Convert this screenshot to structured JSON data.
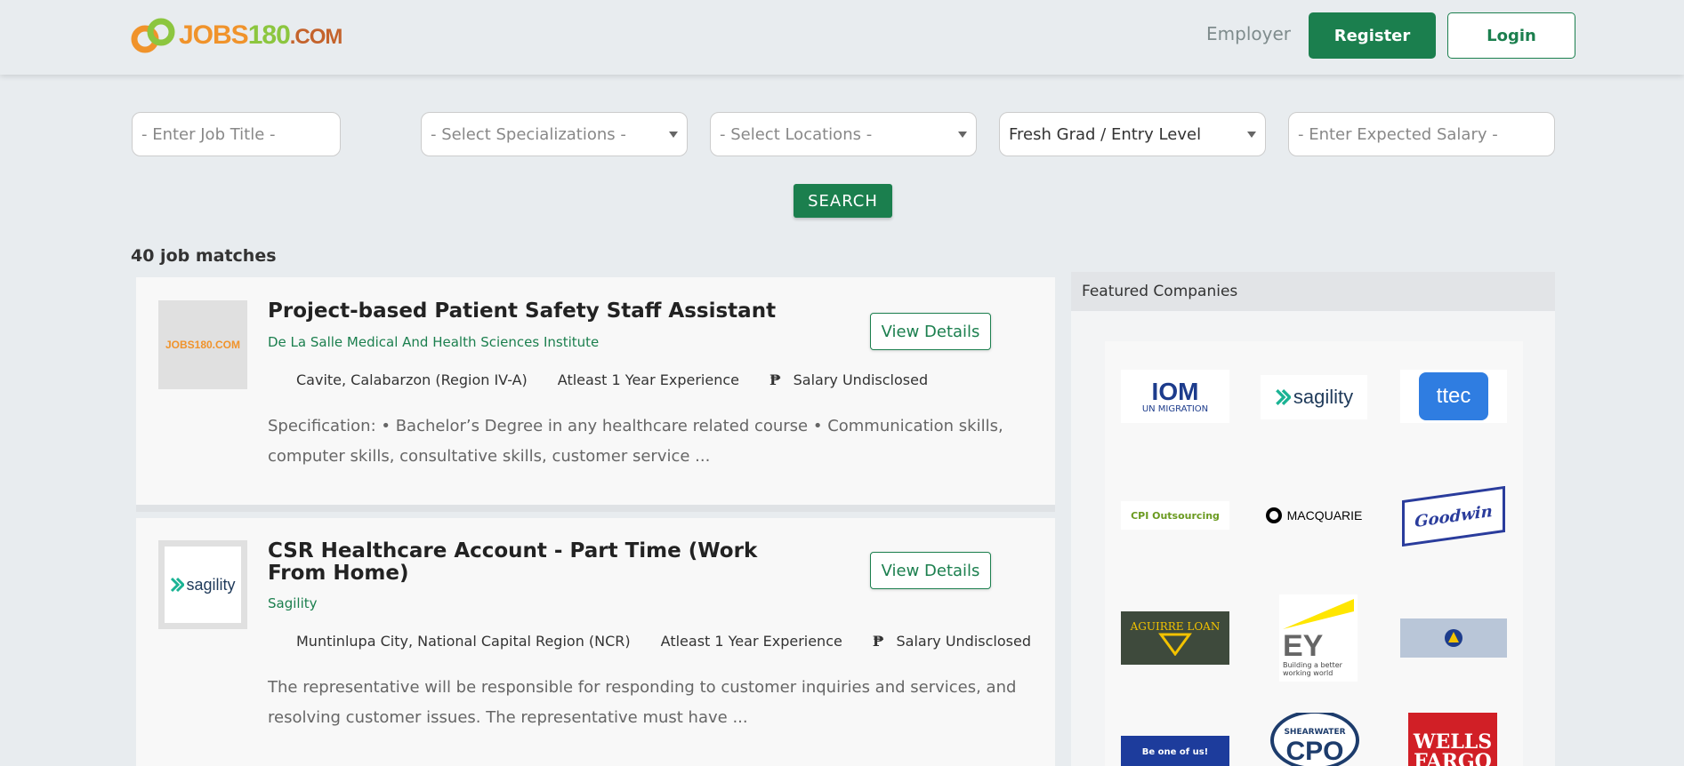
{
  "header": {
    "logo": {
      "jobs": "JOBS",
      "num": "180",
      "com": ".COM"
    },
    "employer_label": "Employer",
    "register_label": "Register",
    "login_label": "Login"
  },
  "search": {
    "job_title_placeholder": "- Enter Job Title -",
    "specialization": "- Select Specializations -",
    "location": "- Select Locations -",
    "level": "Fresh Grad / Entry Level",
    "salary_placeholder": "- Enter Expected Salary -",
    "search_label": "SEARCH"
  },
  "results": {
    "count_label": "40 job matches",
    "jobs": [
      {
        "title": "Project-based Patient Safety Staff Assistant",
        "company": "De La Salle Medical And Health Sciences Institute",
        "location": "Cavite, Calabarzon (Region IV-A)",
        "experience": "Atleast 1 Year Experience",
        "currency": "₱",
        "salary": "Salary Undisclosed",
        "description": "Specification: • Bachelor’s Degree in any healthcare related course • Communication skills, computer skills, consultative skills, customer service ...",
        "view_label": "View Details",
        "logo_text": "JOBS180.COM"
      },
      {
        "title": "CSR Healthcare Account - Part Time (Work From Home)",
        "company": "Sagility",
        "location": "Muntinlupa City, National Capital Region (NCR)",
        "experience": "Atleast 1 Year Experience",
        "currency": "₱",
        "salary": "Salary Undisclosed",
        "description": "The representative will be responsible for responding to customer inquiries and services, and resolving customer issues. The representative must have ...",
        "view_label": "View Details",
        "logo_text": "sagility"
      }
    ]
  },
  "featured": {
    "title": "Featured Companies",
    "companies": [
      {
        "name": "IOM",
        "sub": "UN MIGRATION"
      },
      {
        "name": "sagility"
      },
      {
        "name": "ttec"
      },
      {
        "name": "CPI Outsourcing"
      },
      {
        "name": "MACQUARIE"
      },
      {
        "name": "Goodwin"
      },
      {
        "name": "AGUIRRE LOAN"
      },
      {
        "name": "EY",
        "sub": "Building a better working world"
      },
      {
        "name": "company-banner"
      },
      {
        "name": "Be one of us!"
      },
      {
        "name": "SHEARWATER",
        "sub": "CPO"
      },
      {
        "name": "WELLS FARGO"
      }
    ]
  },
  "colors": {
    "brand_green": "#1b7f4e",
    "logo_orange": "#f0932b",
    "logo_lime": "#8cc63f"
  }
}
